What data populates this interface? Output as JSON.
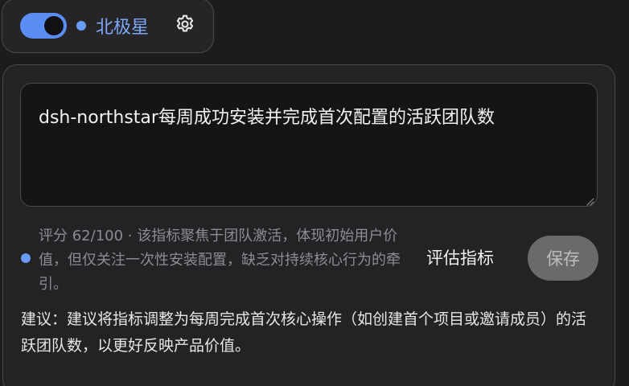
{
  "header": {
    "toggle_on": true,
    "status_color": "#6a9bf7",
    "title": "北极星",
    "settings_icon": "gear-icon"
  },
  "metric": {
    "text": "dsh-northstar每周成功安装并完成首次配置的活跃团队数"
  },
  "evaluation": {
    "summary": "评分 62/100 · 该指标聚焦于团队激活，体现初始用户价值，但仅关注一次性安装配置，缺乏对持续核心行为的牵引。",
    "evaluate_label": "评估指标",
    "save_label": "保存"
  },
  "suggestion": {
    "text": "建议：建议将指标调整为每周完成首次核心操作（如创建首个项目或邀请成员）的活跃团队数，以更好反映产品价值。"
  },
  "colors": {
    "accent": "#5b8ef2",
    "background": "#1c1c1e"
  }
}
